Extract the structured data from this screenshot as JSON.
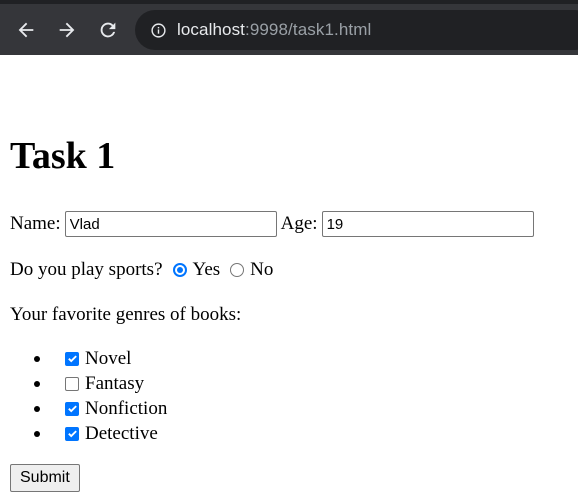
{
  "browser": {
    "url_host": "localhost",
    "url_rest": ":9998/task1.html",
    "icons": {
      "back": "back-arrow-icon",
      "forward": "forward-arrow-icon",
      "reload": "reload-icon",
      "info": "info-icon"
    }
  },
  "page": {
    "title": "Task 1",
    "name_label": "Name:",
    "name_value": "Vlad",
    "age_label": "Age:",
    "age_value": "19",
    "sports_question": "Do you play sports?",
    "sports_options": [
      {
        "label": "Yes",
        "selected": true
      },
      {
        "label": "No",
        "selected": false
      }
    ],
    "genres_question": "Your favorite genres of books:",
    "genres": [
      {
        "label": "Novel",
        "checked": true
      },
      {
        "label": "Fantasy",
        "checked": false
      },
      {
        "label": "Nonfiction",
        "checked": true
      },
      {
        "label": "Detective",
        "checked": true
      }
    ],
    "submit_label": "Submit"
  },
  "colors": {
    "chrome_bg": "#35363a",
    "omnibox_bg": "#202124",
    "accent": "#0075ff"
  }
}
